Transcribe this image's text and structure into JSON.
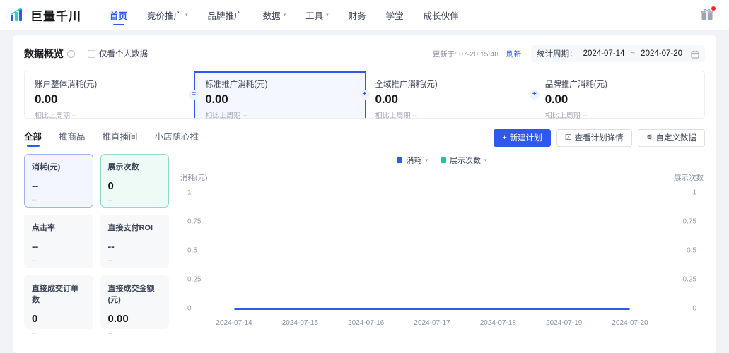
{
  "header": {
    "logo_text": "巨量千川",
    "logo_icon": "bar-chart-logo-icon",
    "gift_icon": "gift-icon",
    "nav": [
      {
        "label": "首页",
        "active": true,
        "has_caret": false
      },
      {
        "label": "竞价推广",
        "active": false,
        "has_caret": true
      },
      {
        "label": "品牌推广",
        "active": false,
        "has_caret": false
      },
      {
        "label": "数据",
        "active": false,
        "has_caret": true
      },
      {
        "label": "工具",
        "active": false,
        "has_caret": true
      },
      {
        "label": "财务",
        "active": false,
        "has_caret": false
      },
      {
        "label": "学堂",
        "active": false,
        "has_caret": false
      },
      {
        "label": "成长伙伴",
        "active": false,
        "has_caret": false
      }
    ]
  },
  "overview": {
    "title": "数据概览",
    "info_icon": "info-circle-icon",
    "checkbox_label": "仅看个人数据",
    "checkbox_checked": false,
    "updated_text": "更新于: 07-20 15:48",
    "refresh_label": "刷新",
    "period_label": "统计周期：",
    "period_start": "2024-07-14",
    "period_separator": "~",
    "period_end": "2024-07-20",
    "calendar_icon": "calendar-icon"
  },
  "kpi_cards": [
    {
      "name": "账户整体消耗(元)",
      "value": "0.00",
      "compare": "相比上周期 --",
      "operator": "=",
      "selected": false
    },
    {
      "name": "标准推广消耗(元)",
      "value": "0.00",
      "compare": "相比上周期 --",
      "operator": "+",
      "selected": true
    },
    {
      "name": "全域推广消耗(元)",
      "value": "0.00",
      "compare": "相比上周期 --",
      "operator": "+",
      "selected": false
    },
    {
      "name": "品牌推广消耗(元)",
      "value": "0.00",
      "compare": "相比上周期 --",
      "operator": "",
      "selected": false
    }
  ],
  "tabs": [
    {
      "label": "全部",
      "active": true
    },
    {
      "label": "推商品",
      "active": false
    },
    {
      "label": "推直播间",
      "active": false
    },
    {
      "label": "小店随心推",
      "active": false
    }
  ],
  "actions": [
    {
      "label": "新建计划",
      "icon": "plus-icon",
      "icon_glyph": "+",
      "primary": true
    },
    {
      "label": "查看计划详情",
      "icon": "checkbox-square-icon",
      "icon_glyph": "☑",
      "primary": false
    },
    {
      "label": "自定义数据",
      "icon": "settings-sliders-icon",
      "icon_glyph": "⚟",
      "primary": false
    }
  ],
  "metric_cards": [
    {
      "name": "消耗(元)",
      "value": "--",
      "sub": "--",
      "state": "sel-blue"
    },
    {
      "name": "展示次数",
      "value": "0",
      "sub": "--",
      "state": "sel-teal"
    },
    {
      "name": "点击率",
      "value": "--",
      "sub": "--",
      "state": ""
    },
    {
      "name": "直接支付ROI",
      "value": "--",
      "sub": "--",
      "state": ""
    },
    {
      "name": "直接成交订单数",
      "value": "0",
      "sub": "--",
      "state": ""
    },
    {
      "name": "直接成交金额(元)",
      "value": "0.00",
      "sub": "--",
      "state": ""
    }
  ],
  "colors": {
    "brand_blue": "#2f59ec",
    "series_consumption": "#2f59ec",
    "series_impressions": "#14c9a2"
  },
  "chart_data": {
    "type": "line",
    "title": "",
    "legend": [
      {
        "name": "消耗",
        "color": "#2f59ec",
        "caret": "˅"
      },
      {
        "name": "展示次数",
        "color": "#14c9a2",
        "caret": "˅"
      }
    ],
    "legend_position": "top-center",
    "ylabel_left": "消耗(元)",
    "ylabel_right": "展示次数",
    "xlabel": "",
    "grid": true,
    "x": [
      "2024-07-14",
      "2024-07-15",
      "2024-07-16",
      "2024-07-17",
      "2024-07-18",
      "2024-07-19",
      "2024-07-20"
    ],
    "yticks_left": [
      "1",
      "0.75",
      "0.5",
      "0.25",
      "0"
    ],
    "yticks_right": [
      "1",
      "0.75",
      "0.5",
      "0.25",
      "0"
    ],
    "ylim_left": [
      0,
      1
    ],
    "ylim_right": [
      0,
      1
    ],
    "series": [
      {
        "name": "消耗",
        "color": "#2f59ec",
        "axis": "left",
        "values": [
          0,
          0,
          0,
          0,
          0,
          0,
          0
        ]
      },
      {
        "name": "展示次数",
        "color": "#14c9a2",
        "axis": "right",
        "values": [
          0,
          0,
          0,
          0,
          0,
          0,
          0
        ]
      }
    ]
  }
}
